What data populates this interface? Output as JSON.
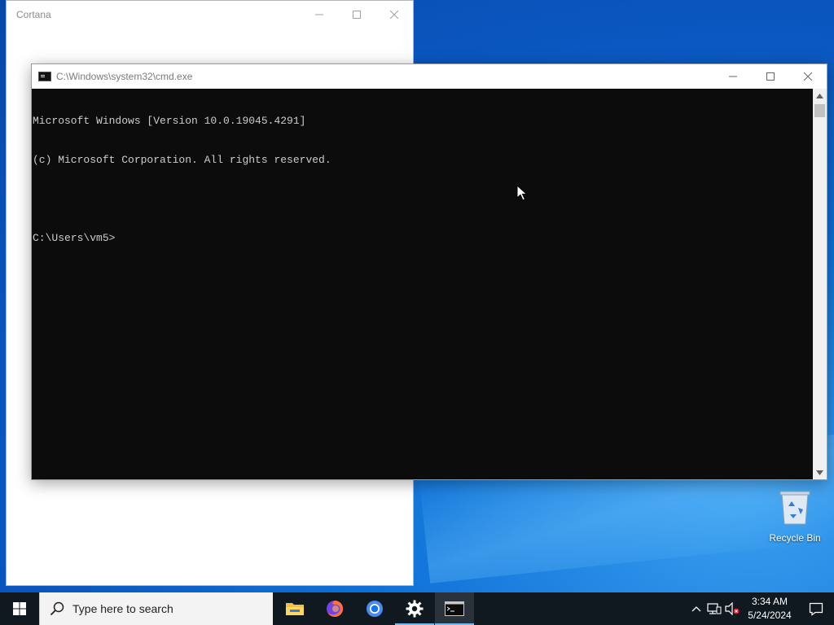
{
  "cortana": {
    "title": "Cortana"
  },
  "cmd": {
    "title": "C:\\Windows\\system32\\cmd.exe",
    "lines": [
      "Microsoft Windows [Version 10.0.19045.4291]",
      "(c) Microsoft Corporation. All rights reserved.",
      "",
      "C:\\Users\\vm5>"
    ]
  },
  "desktop": {
    "recycle_bin_label": "Recycle Bin"
  },
  "taskbar": {
    "search_placeholder": "Type here to search",
    "apps": [
      "file-explorer",
      "firefox",
      "chrome",
      "settings",
      "command-prompt"
    ],
    "clock_time": "3:34 AM",
    "clock_date": "5/24/2024"
  },
  "colors": {
    "console_bg": "#0c0c0c",
    "console_fg": "#cccccc",
    "taskbar_bg": "#101820",
    "desktop_accent": "#0a58c2"
  }
}
